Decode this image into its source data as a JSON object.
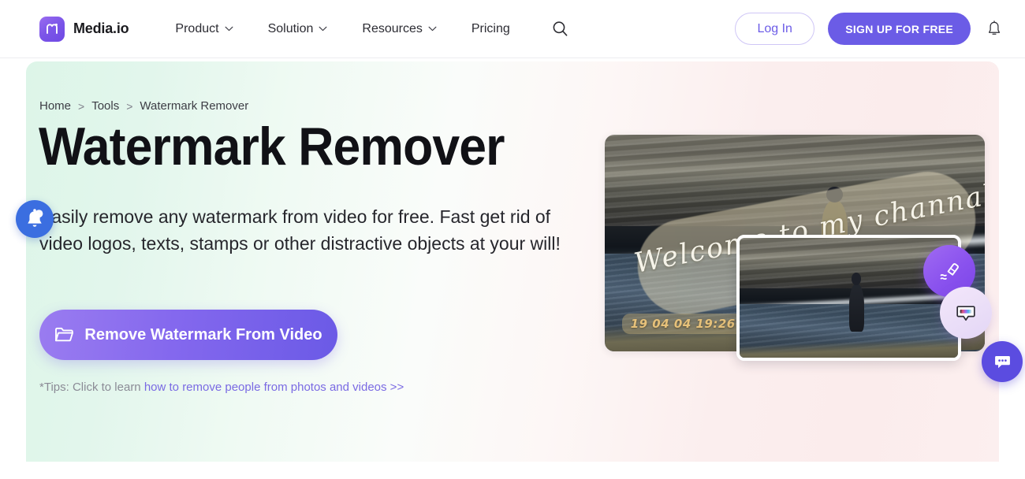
{
  "navbar": {
    "brand": {
      "name": "Media.io",
      "logo_icon": "media-io-logo-icon",
      "logo_color": "#7b55e8"
    },
    "links": [
      {
        "label": "Product",
        "has_dropdown": true
      },
      {
        "label": "Solution",
        "has_dropdown": true
      },
      {
        "label": "Resources",
        "has_dropdown": true
      },
      {
        "label": "Pricing",
        "has_dropdown": false
      }
    ],
    "search_icon": "search-icon",
    "login_label": "Log In",
    "signup_label": "SIGN UP FOR FREE",
    "notification_icon": "bell-icon",
    "accent_color": "#6b5ce6",
    "login_text_color": "#6c5ce7"
  },
  "hero": {
    "breadcrumb": [
      {
        "label": "Home"
      },
      {
        "label": "Tools"
      },
      {
        "label": "Watermark Remover"
      }
    ],
    "breadcrumb_separator": ">",
    "title": "Watermark Remover",
    "description": "Easily remove any watermark from video for free. Fast get rid of video logos, texts, stamps or other distractive objects at your will!",
    "cta": {
      "label": "Remove Watermark From Video",
      "icon": "folder-icon"
    },
    "tips_prefix": "*Tips: Click to learn ",
    "tips_link": "how to remove people from photos and videos >>",
    "background_gradient": [
      "#ddf5e8",
      "#fafcfa",
      "#fbecec"
    ]
  },
  "preview": {
    "back_photo": {
      "watermark_text": "Welcome to my channal",
      "timestamp": "19 04 04 19:26",
      "alt": "rocky-shoreline-with-person-photo"
    },
    "front_photo": {
      "alt": "cleaned-shoreline-photo-without-watermark"
    },
    "badges": [
      {
        "icon": "eraser-icon",
        "color": "#8a52ee"
      },
      {
        "icon": "chat-bubble-color-icon",
        "color": "#ece0f8"
      }
    ]
  },
  "widgets": {
    "notification_bubble": {
      "icon": "bell-icon",
      "color": "#3b6ee0"
    },
    "chat_bubble": {
      "icon": "chat-dots-icon",
      "color": "#5b4ce0"
    }
  }
}
